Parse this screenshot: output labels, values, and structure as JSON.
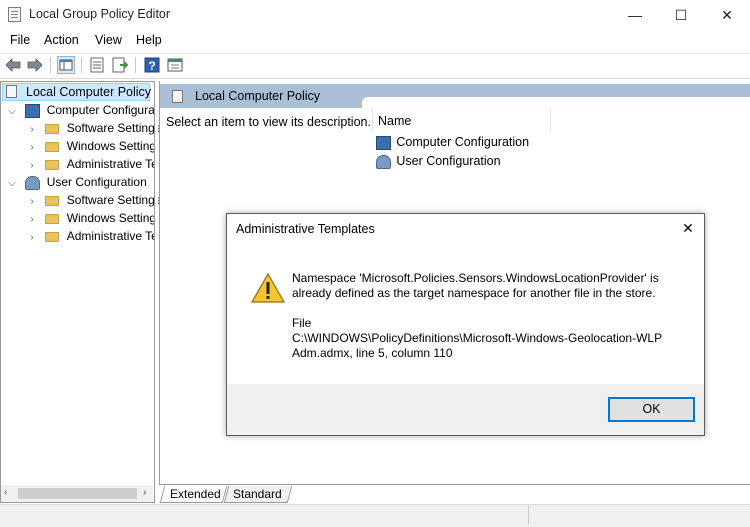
{
  "window": {
    "title": "Local Group Policy Editor",
    "minimize_glyph": "—",
    "maximize_glyph": "☐",
    "close_glyph": "✕"
  },
  "menu": [
    "File",
    "Action",
    "View",
    "Help"
  ],
  "toolbar_icons": [
    "back-arrow-icon",
    "forward-arrow-icon",
    "show-tree-icon",
    "properties-icon",
    "export-list-icon",
    "help-icon",
    "extended-view-icon"
  ],
  "tree": {
    "root": "Local Computer Policy",
    "computer_config": "Computer Configura",
    "computer_children": [
      "Software Settings",
      "Windows Setting",
      "Administrative Te"
    ],
    "user_config": "User Configuration",
    "user_children": [
      "Software Settings",
      "Windows Setting",
      "Administrative Te"
    ]
  },
  "right_pane": {
    "header": "Local Computer Policy",
    "description": "Select an item to view its description.",
    "column_name": "Name",
    "items": [
      "Computer Configuration",
      "User Configuration"
    ]
  },
  "bottom_tabs": [
    "Extended",
    "Standard"
  ],
  "dialog": {
    "title": "Administrative Templates",
    "message_line1": "Namespace 'Microsoft.Policies.Sensors.WindowsLocationProvider' is",
    "message_line2": "already defined as the target namespace for another file in the store.",
    "file_label": "File",
    "file_line1": "C:\\WINDOWS\\PolicyDefinitions\\Microsoft-Windows-Geolocation-WLP",
    "file_line2": "Adm.admx, line 5, column 110",
    "ok_label": "OK"
  }
}
